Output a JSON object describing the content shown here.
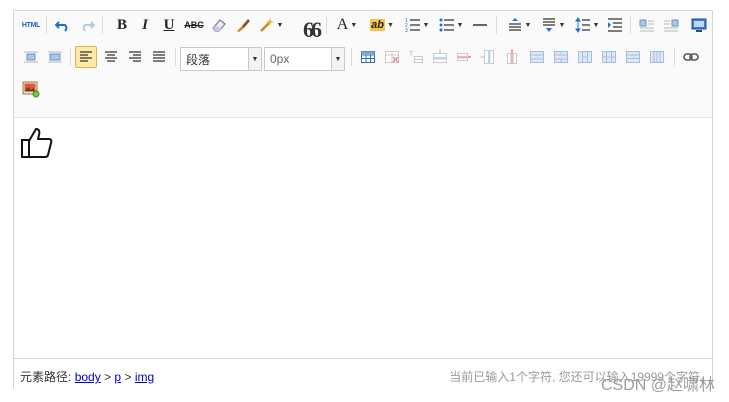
{
  "toolbar": {
    "html_label": "HTML",
    "quote_label": "66",
    "paragraph_select": {
      "value": "段落"
    },
    "spacing_select": {
      "value": "0px"
    }
  },
  "status": {
    "path_label": "元素路径:",
    "path_items": [
      "body",
      "p",
      "img"
    ],
    "path_separator": ">",
    "word_count": "当前已输入1个字符, 您还可以输入19999个字符。"
  },
  "watermark": "CSDN @赵啸林",
  "colors": {
    "active_bg": "#fde9a8",
    "link": "#0000cc",
    "border": "#d4d4d4"
  },
  "content": {
    "image_icon": "thumbs-up-icon"
  }
}
